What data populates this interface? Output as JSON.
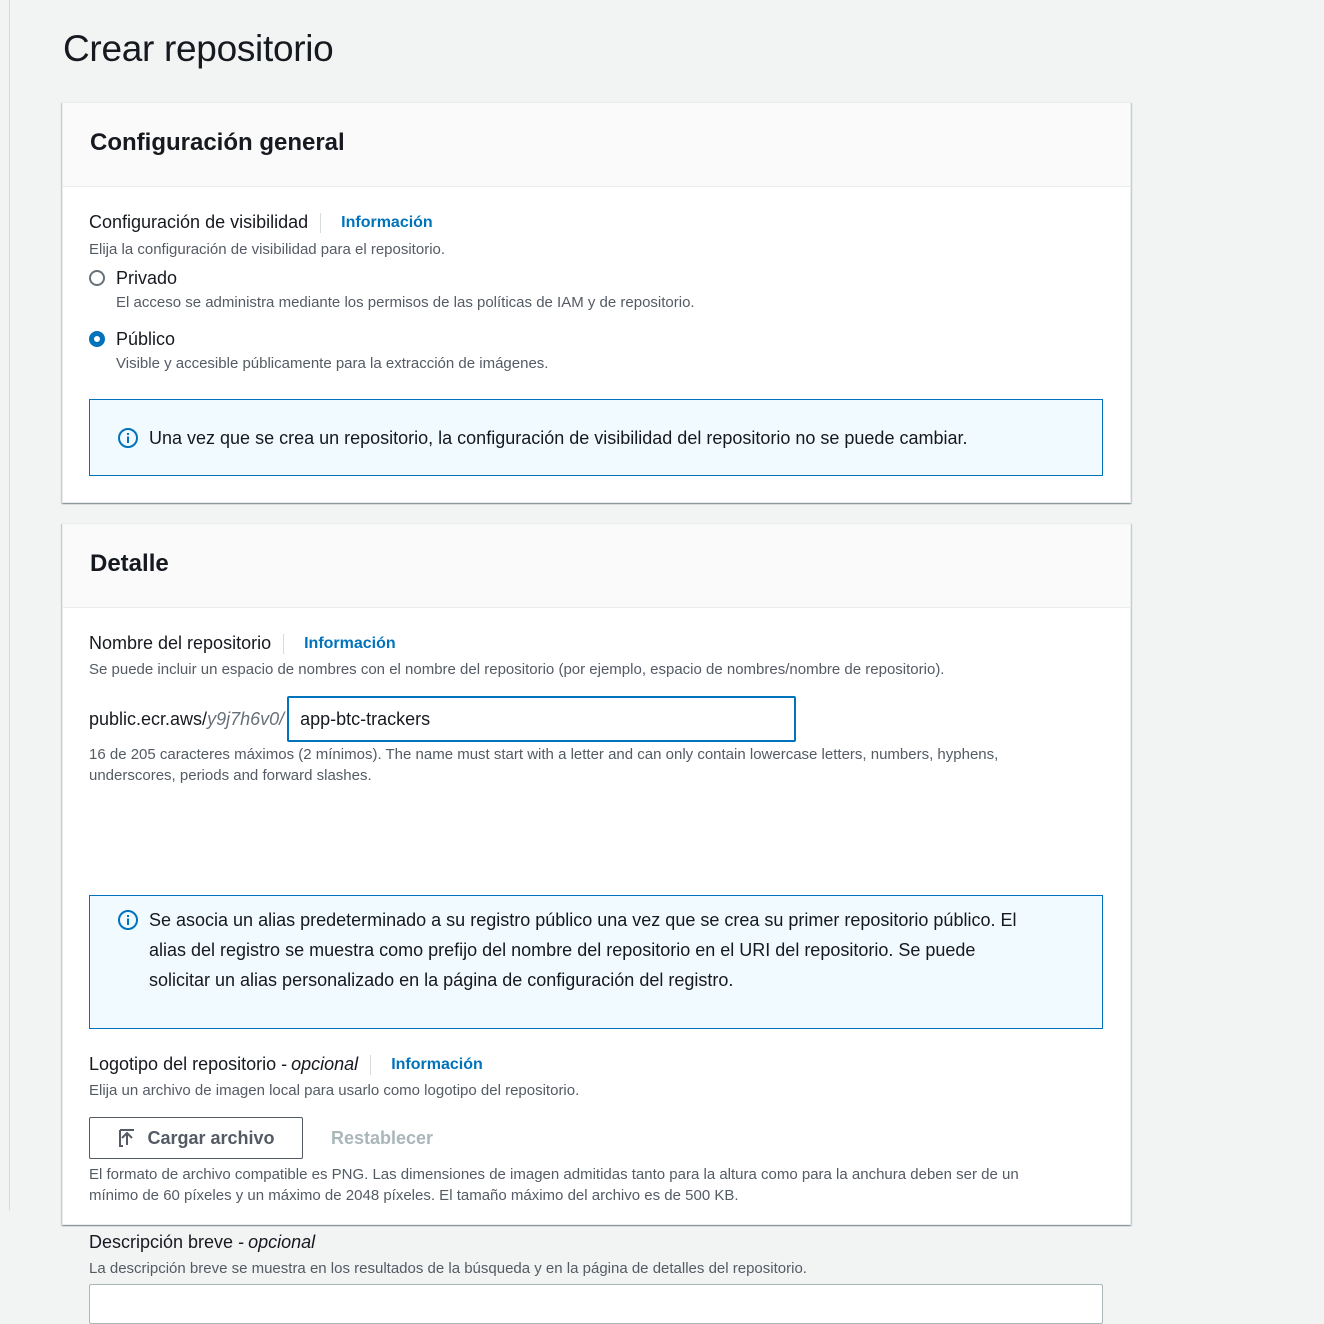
{
  "page": {
    "title": "Crear repositorio"
  },
  "general": {
    "title": "Configuración general",
    "visibility": {
      "label": "Configuración de visibilidad",
      "info": "Información",
      "description": "Elija la configuración de visibilidad para el repositorio.",
      "options": [
        {
          "label": "Privado",
          "description": "El acceso se administra mediante los permisos de las políticas de IAM y de repositorio.",
          "selected": false
        },
        {
          "label": "Público",
          "description": "Visible y accesible públicamente para la extracción de imágenes.",
          "selected": true
        }
      ]
    },
    "alert": "Una vez que se crea un repositorio, la configuración de visibilidad del repositorio no se puede cambiar."
  },
  "detail": {
    "title": "Detalle",
    "name": {
      "label": "Nombre del repositorio",
      "info": "Información",
      "description": "Se puede incluir un espacio de nombres con el nombre del repositorio (por ejemplo, espacio de nombres/nombre de repositorio).",
      "prefix": "public.ecr.aws/",
      "alias": "y9j7h6v0/",
      "value": "app-btc-trackers",
      "hint_line1": "16 de 205 caracteres máximos (2 mínimos). The name must start with a letter and can only contain lowercase letters, numbers, hyphens,",
      "hint_line2": "underscores, periods and forward slashes."
    },
    "alias_alert": {
      "line1": "Se asocia un alias predeterminado a su registro público una vez que se crea su primer repositorio público. El",
      "line2": "alias del registro se muestra como prefijo del nombre del repositorio en el URI del repositorio. Se puede",
      "line3": "solicitar un alias personalizado en la página de configuración del registro."
    },
    "logo": {
      "label": "Logotipo del repositorio -",
      "optional": "opcional",
      "info": "Información",
      "description": "Elija un archivo de imagen local para usarlo como logotipo del repositorio.",
      "upload_button": "Cargar archivo",
      "reset_button": "Restablecer",
      "hint_line1": "El formato de archivo compatible es PNG. Las dimensiones de imagen admitidas tanto para la altura como para la anchura deben ser de un",
      "hint_line2": "mínimo de 60 píxeles y un máximo de 2048 píxeles. El tamaño máximo del archivo es de 500 KB."
    },
    "short_description": {
      "label": "Descripción breve -",
      "optional": "opcional",
      "description": "La descripción breve se muestra en los resultados de la búsqueda y en la página de detalles del repositorio."
    }
  },
  "icons": {
    "info": "info-circle-icon",
    "upload": "upload-icon"
  },
  "colors": {
    "accent": "#0073bb",
    "alert_bg": "#f1faff",
    "text": "#16191f",
    "secondary": "#545b64",
    "disabled": "#aab7b8"
  }
}
